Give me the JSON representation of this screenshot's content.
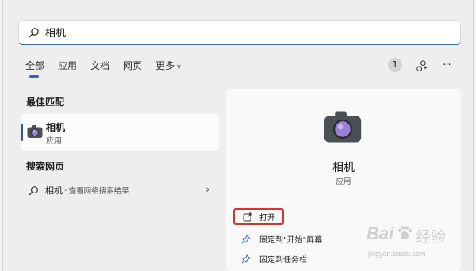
{
  "search": {
    "query": "相机"
  },
  "tabs": [
    {
      "label": "全部",
      "active": true
    },
    {
      "label": "应用"
    },
    {
      "label": "文档"
    },
    {
      "label": "网页"
    },
    {
      "label": "更多"
    }
  ],
  "toolbar": {
    "badge_count": "1",
    "more": "···"
  },
  "best_match": {
    "heading": "最佳匹配",
    "title": "相机",
    "subtitle": "应用"
  },
  "web_search": {
    "heading": "搜索网页",
    "title": "相机",
    "separator": "-",
    "subtitle": "查看网络搜索结果"
  },
  "detail": {
    "title": "相机",
    "subtitle": "应用",
    "actions": [
      {
        "label": "打开",
        "icon": "open-icon"
      },
      {
        "label": "固定到\"开始\"屏幕",
        "icon": "pin-icon"
      },
      {
        "label": "固定到任务栏",
        "icon": "pin-icon"
      }
    ]
  },
  "watermark": {
    "brand": "Bai",
    "brand2": "经验",
    "url": "jingyan.baidu.com"
  },
  "colors": {
    "accent": "#3a63b5",
    "highlight_border": "#d9322b",
    "camera_lens": "#9b7fd6"
  }
}
